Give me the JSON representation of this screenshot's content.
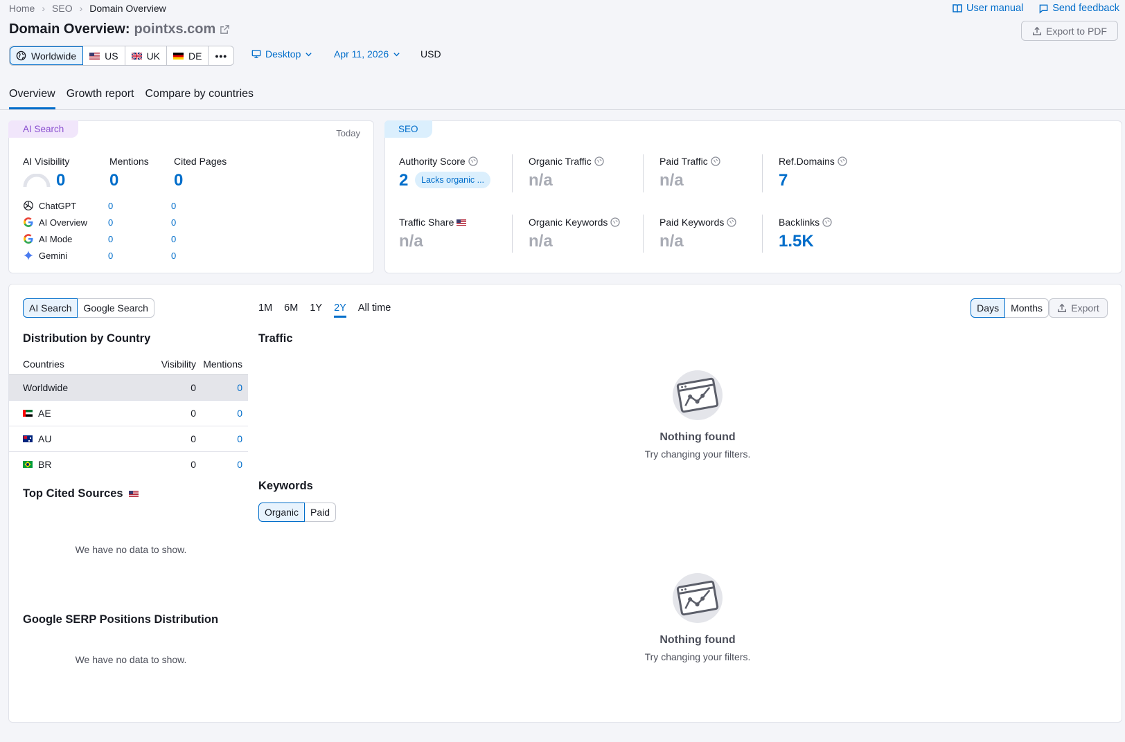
{
  "breadcrumb": {
    "home": "Home",
    "seo": "SEO",
    "current": "Domain Overview"
  },
  "toplinks": {
    "manual": "User manual",
    "feedback": "Send feedback"
  },
  "header": {
    "title": "Domain Overview:",
    "domain": "pointxs.com",
    "export_pdf": "Export to PDF"
  },
  "regions": [
    {
      "label": "Worldwide",
      "icon": "globe-icon",
      "active": true
    },
    {
      "label": "US",
      "icon": "us-flag-icon"
    },
    {
      "label": "UK",
      "icon": "uk-flag-icon"
    },
    {
      "label": "DE",
      "icon": "de-flag-icon"
    }
  ],
  "filters": {
    "device": "Desktop",
    "date": "Apr 11, 2026",
    "currency": "USD"
  },
  "tabs": [
    {
      "label": "Overview",
      "active": true
    },
    {
      "label": "Growth report"
    },
    {
      "label": "Compare by countries"
    }
  ],
  "ai_card": {
    "tag": "AI Search",
    "today": "Today",
    "visibility_label": "AI Visibility",
    "visibility_value": "0",
    "mentions_label": "Mentions",
    "mentions_value": "0",
    "cited_label": "Cited Pages",
    "cited_value": "0",
    "sources": [
      {
        "name": "ChatGPT",
        "mentions": "0",
        "cited": "0",
        "icon": "chatgpt-icon"
      },
      {
        "name": "AI Overview",
        "mentions": "0",
        "cited": "0",
        "icon": "google-icon"
      },
      {
        "name": "AI Mode",
        "mentions": "0",
        "cited": "0",
        "icon": "google-icon"
      },
      {
        "name": "Gemini",
        "mentions": "0",
        "cited": "0",
        "icon": "gemini-icon"
      }
    ]
  },
  "seo_card": {
    "tag": "SEO",
    "authority_label": "Authority Score",
    "authority_value": "2",
    "authority_pill": "Lacks organic ...",
    "organic_traffic_label": "Organic Traffic",
    "organic_traffic_value": "n/a",
    "paid_traffic_label": "Paid Traffic",
    "paid_traffic_value": "n/a",
    "ref_domains_label": "Ref.Domains",
    "ref_domains_value": "7",
    "traffic_share_label": "Traffic Share",
    "traffic_share_value": "n/a",
    "organic_keywords_label": "Organic Keywords",
    "organic_keywords_value": "n/a",
    "paid_keywords_label": "Paid Keywords",
    "paid_keywords_value": "n/a",
    "backlinks_label": "Backlinks",
    "backlinks_value": "1.5K"
  },
  "lower": {
    "toggle": [
      "AI Search",
      "Google Search"
    ],
    "periods": [
      "1M",
      "6M",
      "1Y",
      "2Y",
      "All time"
    ],
    "active_period": "2Y",
    "granularity": [
      "Days",
      "Months"
    ],
    "export": "Export",
    "distribution_title": "Distribution by Country",
    "columns": [
      "Countries",
      "Visibility",
      "Mentions"
    ],
    "countries": [
      {
        "name": "Worldwide",
        "visibility": "0",
        "mentions": "0"
      },
      {
        "name": "AE",
        "visibility": "0",
        "mentions": "0"
      },
      {
        "name": "AU",
        "visibility": "0",
        "mentions": "0"
      },
      {
        "name": "BR",
        "visibility": "0",
        "mentions": "0"
      }
    ],
    "top_cited_title": "Top Cited Sources",
    "no_data": "We have no data to show.",
    "serp_title": "Google SERP Positions Distribution",
    "serp_no_data": "We have no data to show.",
    "traffic_title": "Traffic",
    "keywords_title": "Keywords",
    "keywords_toggle": [
      "Organic",
      "Paid"
    ],
    "empty_title": "Nothing found",
    "empty_sub": "Try changing your filters."
  }
}
